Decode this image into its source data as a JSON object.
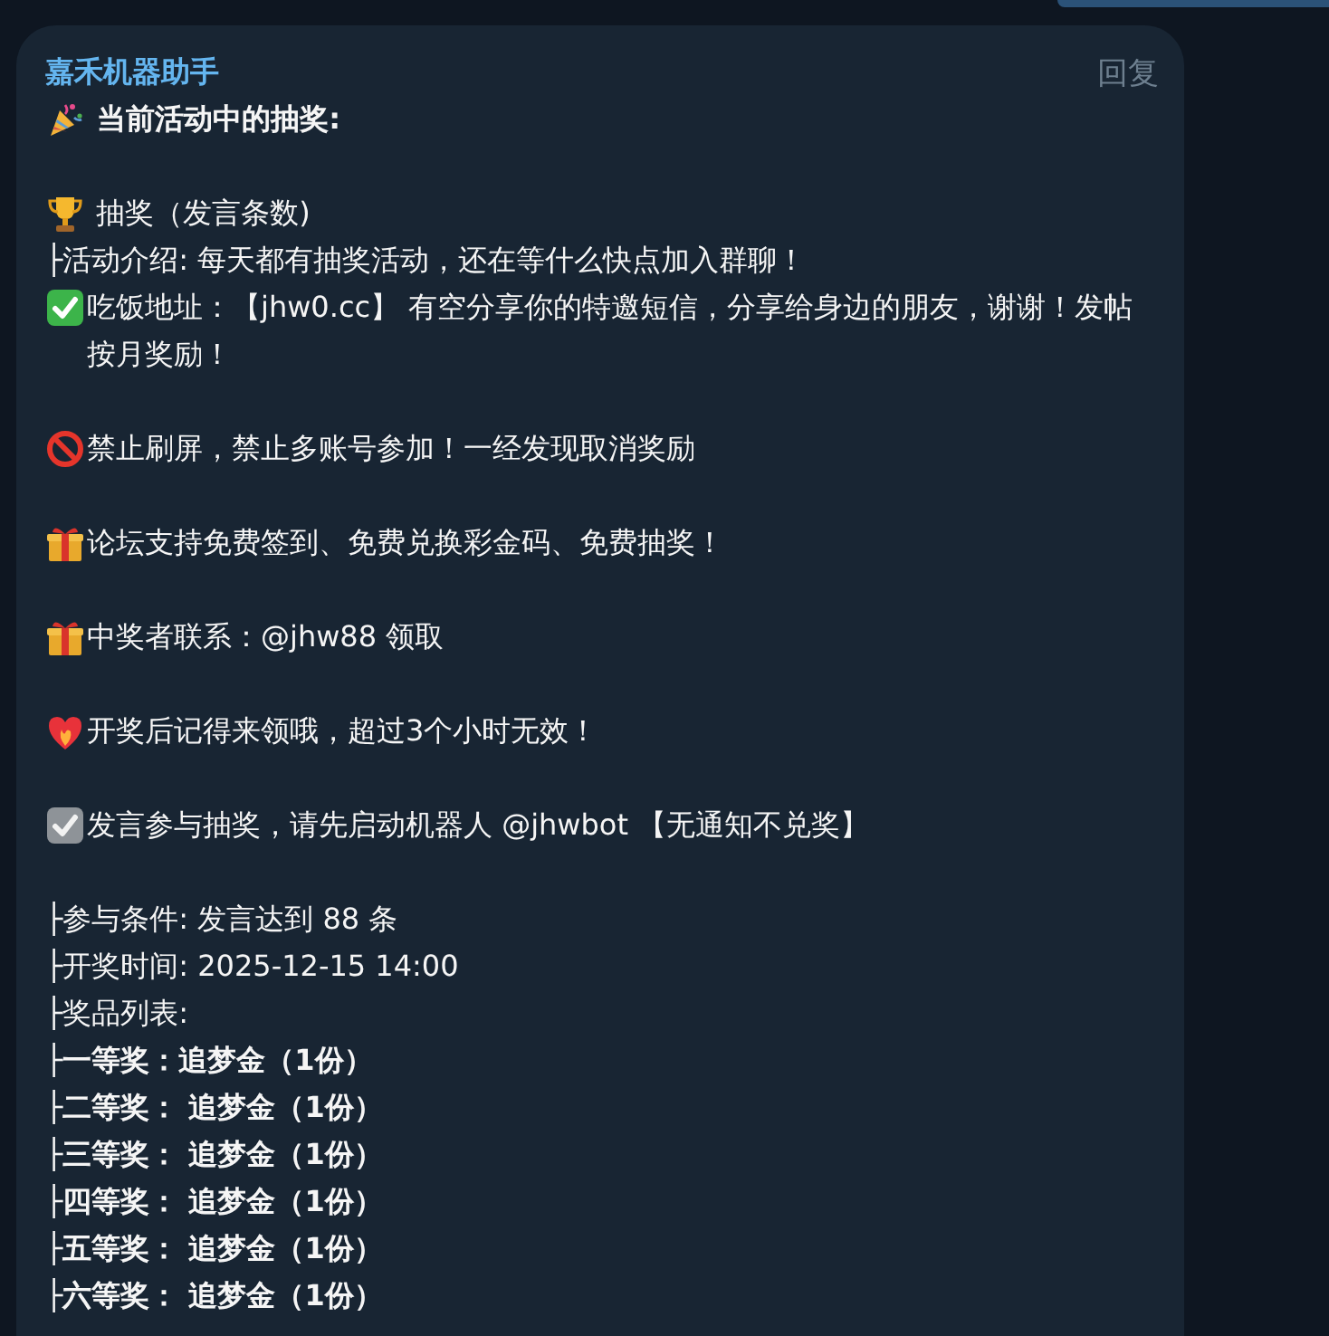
{
  "previous_message": {
    "kind": "outgoing"
  },
  "message": {
    "sender": "嘉禾机器助手",
    "reply_label": "回复",
    "lines": [
      {
        "kind": "party",
        "text": " 当前活动中的抽奖:",
        "bold": true
      },
      {
        "kind": "blank"
      },
      {
        "kind": "trophy",
        "text": " 抽奖（发言条数)",
        "bold": false
      },
      {
        "kind": "text",
        "text": "├活动介绍: 每天都有抽奖活动，还在等什么快点加入群聊！",
        "bold": false
      },
      {
        "kind": "check",
        "text": "吃饭地址：【jhw0.cc】 有空分享你的特邀短信，分享给身边的朋友，谢谢！发帖按月奖励！",
        "bold": false
      },
      {
        "kind": "blank"
      },
      {
        "kind": "forbidden",
        "text": "禁止刷屏，禁止多账号参加！一经发现取消奖励",
        "bold": false
      },
      {
        "kind": "blank"
      },
      {
        "kind": "gift",
        "text": "论坛支持免费签到、免费兑换彩金码、免费抽奖！",
        "bold": false
      },
      {
        "kind": "blank"
      },
      {
        "kind": "gift",
        "text": "中奖者联系：@jhw88 领取",
        "bold": false
      },
      {
        "kind": "blank"
      },
      {
        "kind": "fire_heart",
        "text": "开奖后记得来领哦，超过3个小时无效！",
        "bold": false
      },
      {
        "kind": "blank"
      },
      {
        "kind": "ballot",
        "text": "发言参与抽奖，请先启动机器人 @jhwbot 【无通知不兑奖】",
        "bold": false
      },
      {
        "kind": "blank"
      },
      {
        "kind": "text",
        "text": "├参与条件: 发言达到 88 条",
        "bold": false
      },
      {
        "kind": "text",
        "text": "├开奖时间: 2025-12-15 14:00",
        "bold": false
      },
      {
        "kind": "text",
        "text": "├奖品列表:",
        "bold": false
      },
      {
        "kind": "text",
        "text": "├一等奖：追梦金（1份）",
        "bold": true
      },
      {
        "kind": "text",
        "text": "├二等奖： 追梦金（1份）",
        "bold": true
      },
      {
        "kind": "text",
        "text": "├三等奖： 追梦金（1份）",
        "bold": true
      },
      {
        "kind": "text",
        "text": "├四等奖： 追梦金（1份）",
        "bold": true
      },
      {
        "kind": "text",
        "text": "├五等奖： 追梦金（1份）",
        "bold": true
      },
      {
        "kind": "text",
        "text": "├六等奖： 追梦金（1份）",
        "bold": true
      }
    ]
  }
}
